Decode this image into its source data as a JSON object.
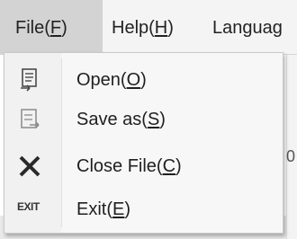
{
  "menubar": {
    "file": {
      "before": "File(",
      "key": "F",
      "after": ")"
    },
    "help": {
      "before": "Help(",
      "key": "H",
      "after": ")"
    },
    "language": {
      "label": "Languag"
    }
  },
  "dropdown": {
    "items": [
      {
        "before": "Open(",
        "key": "O",
        "after": ")",
        "icon": "open-file-icon"
      },
      {
        "before": "Save as(",
        "key": "S",
        "after": ")",
        "icon": "save-as-icon"
      },
      {
        "before": "Close File(",
        "key": "C",
        "after": ")",
        "icon": "close-x-icon"
      },
      {
        "before": "Exit(",
        "key": "E",
        "after": ")",
        "icon": "exit-icon",
        "icon_text": "EXIT"
      }
    ]
  },
  "background": {
    "partial_glyph": "0"
  }
}
